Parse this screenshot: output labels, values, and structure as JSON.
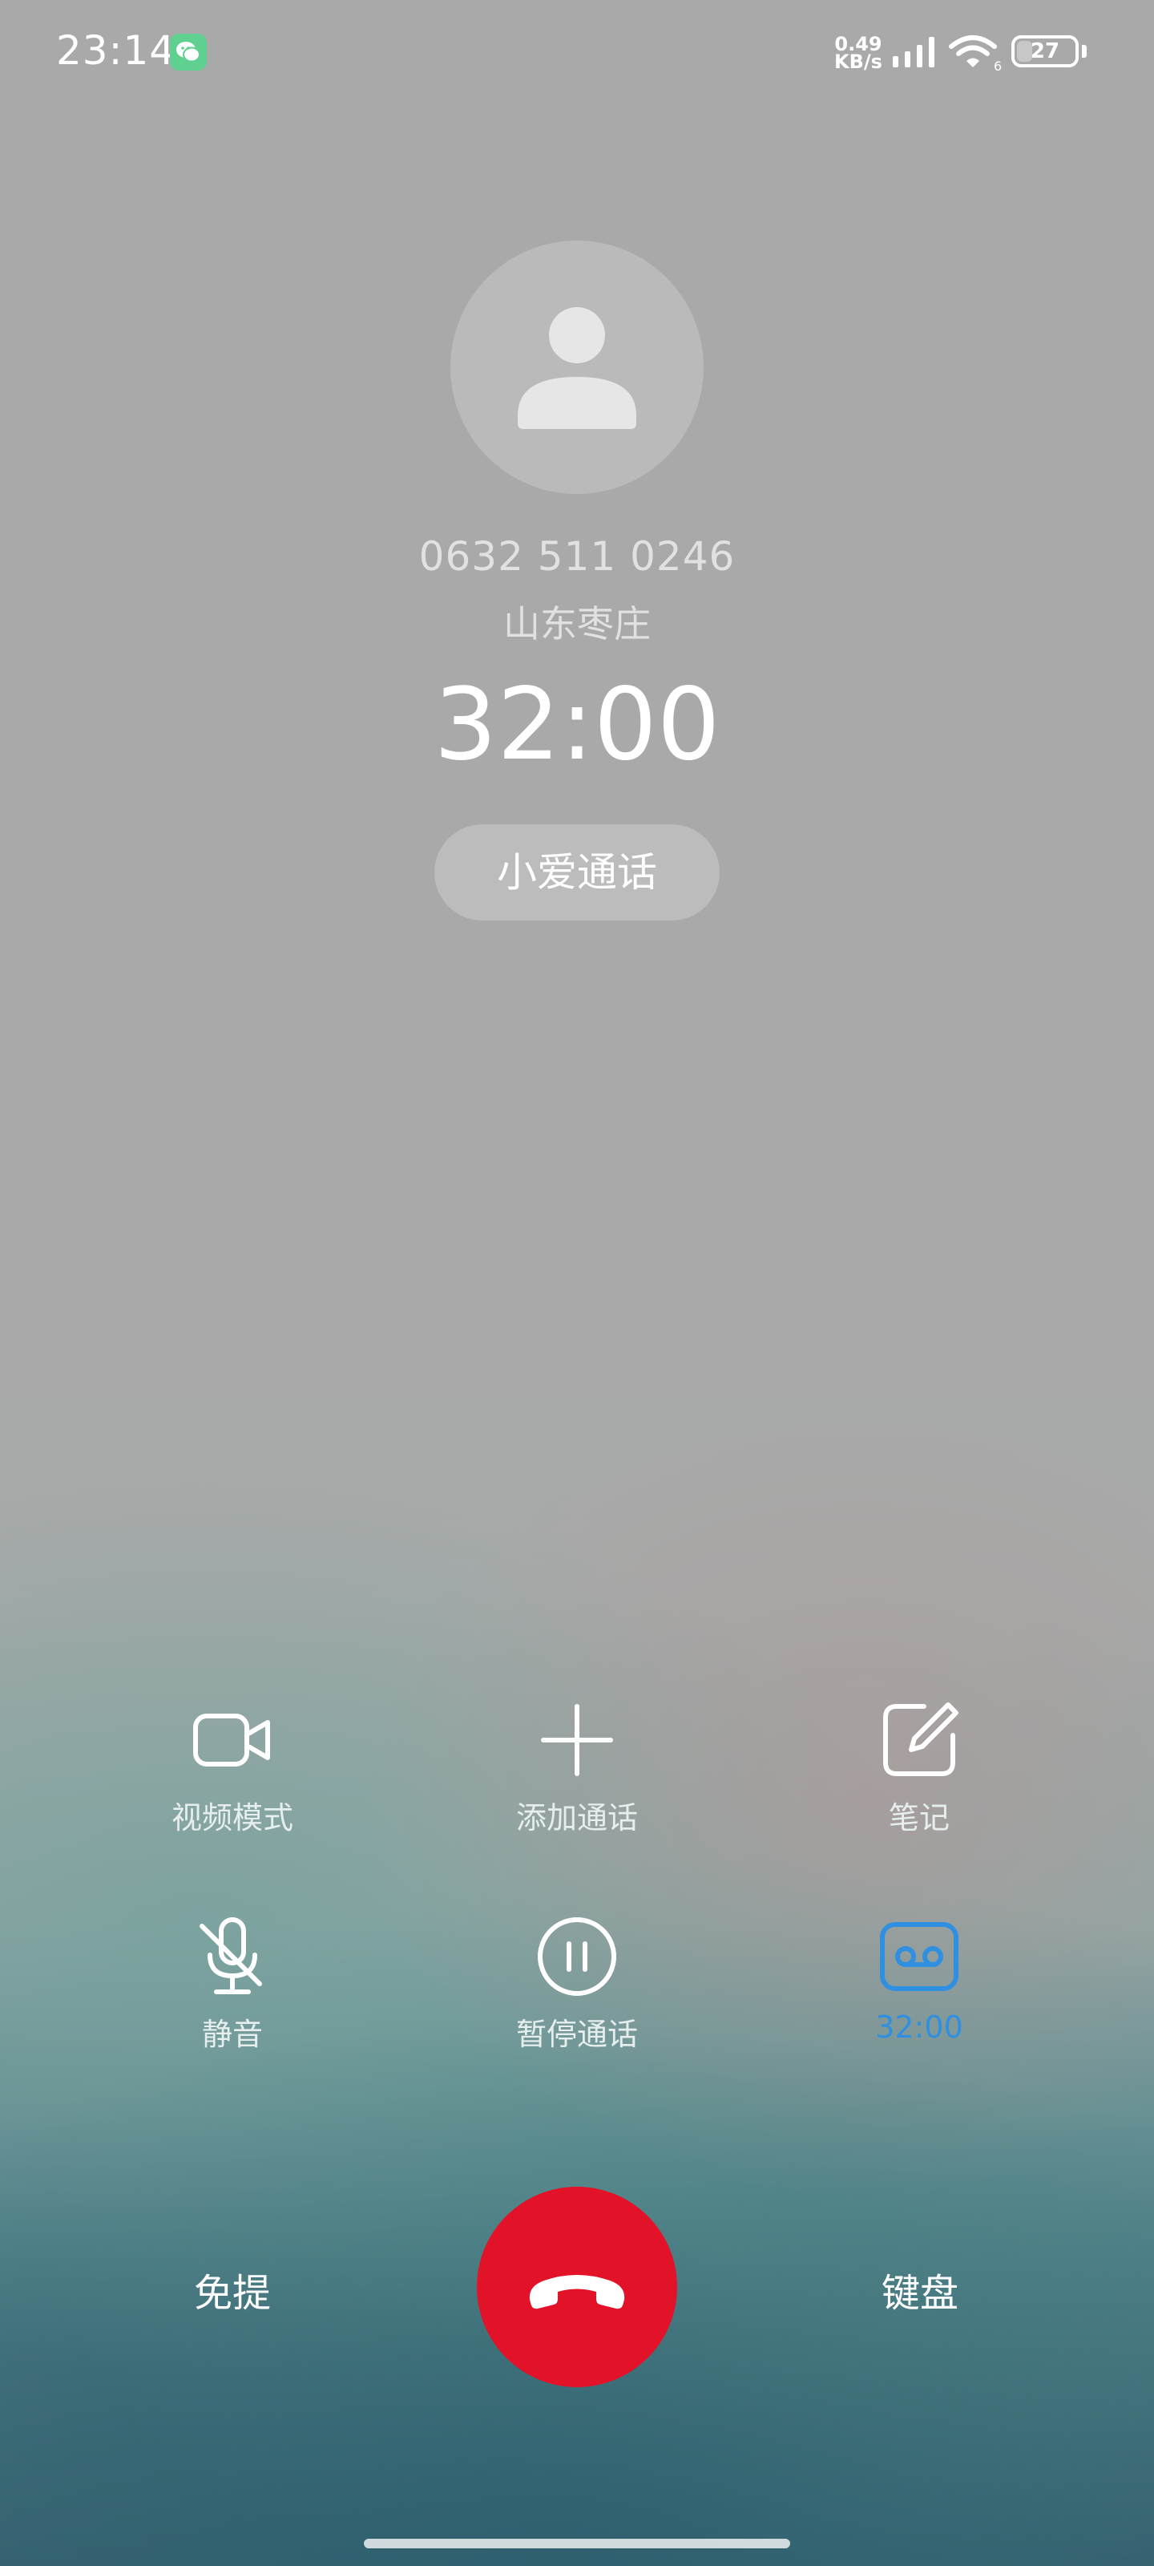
{
  "status_bar": {
    "time": "23:14",
    "notification_app_icon": "wechat-icon",
    "net_speed_value": "0.49",
    "net_speed_unit": "KB/s",
    "signal_icon": "cellular-signal-icon",
    "wifi_icon": "wifi-icon",
    "wifi_badge": "6",
    "battery_level": "27",
    "battery_fraction": 0.27
  },
  "caller": {
    "avatar_icon": "person-icon",
    "number": "0632 511 0246",
    "location": "山东枣庄",
    "duration": "32:00"
  },
  "assistant_button": {
    "label": "小爱通话"
  },
  "controls": {
    "video_mode": {
      "label": "视频模式",
      "icon": "video-camera-icon"
    },
    "add_call": {
      "label": "添加通话",
      "icon": "plus-icon"
    },
    "notes": {
      "label": "笔记",
      "icon": "edit-note-icon"
    },
    "mute": {
      "label": "静音",
      "icon": "mic-off-icon"
    },
    "hold": {
      "label": "暂停通话",
      "icon": "pause-icon"
    },
    "record": {
      "label": "32:00",
      "icon": "voicemail-record-icon",
      "active_color": "#2f8fe0"
    }
  },
  "bottom": {
    "speaker_label": "免提",
    "keypad_label": "键盘",
    "end_call_icon": "hang-up-icon",
    "end_call_color": "#e21328"
  }
}
